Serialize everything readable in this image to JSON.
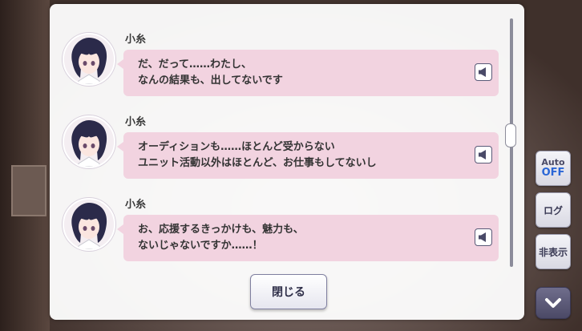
{
  "log": {
    "entries": [
      {
        "speaker": "小糸",
        "lines": [
          "だ、だって……わたし、",
          "なんの結果も、出してないです"
        ]
      },
      {
        "speaker": "小糸",
        "lines": [
          "オーディションも……ほとんど受からない",
          "ユニット活動以外はほとんど、お仕事もしてないし"
        ]
      },
      {
        "speaker": "小糸",
        "lines": [
          "お、応援するきっかけも、魅力も、",
          "ないじゃないですか……！"
        ]
      }
    ],
    "close_label": "閉じる"
  },
  "side_controls": {
    "auto_label": "Auto",
    "auto_state": "OFF",
    "log_label": "ログ",
    "hide_label": "非表示"
  },
  "colors": {
    "bubble": "#f2d3e0",
    "auto_off": "#2a66d6",
    "panel": "#ffffff"
  },
  "icons": {
    "voice": "speaker-icon",
    "down": "chevron-down-icon"
  }
}
